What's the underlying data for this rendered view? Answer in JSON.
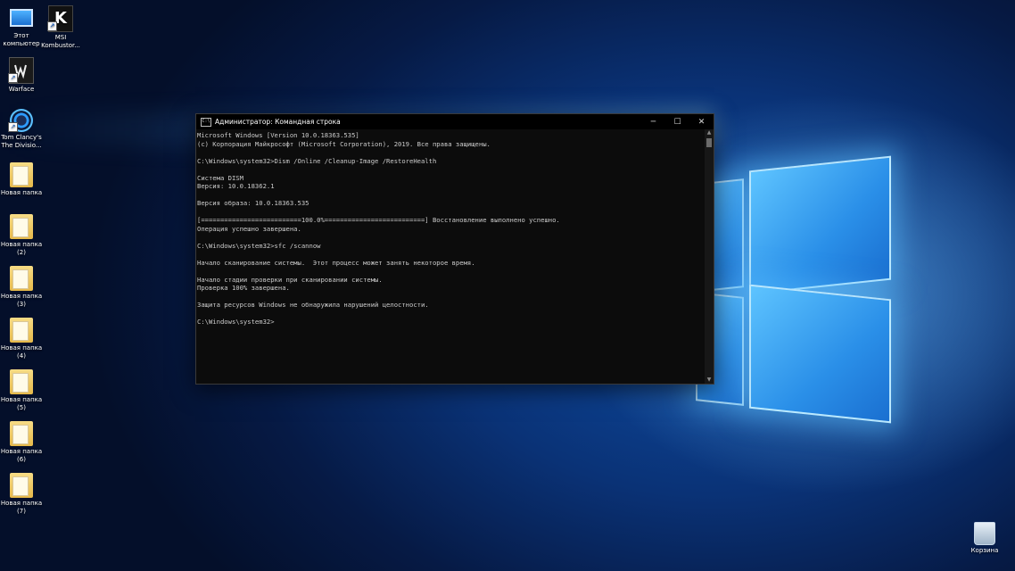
{
  "desktop": {
    "icons": [
      {
        "label": "Этот компьютер"
      },
      {
        "label": "MSI Kombustor..."
      },
      {
        "label": "Warface"
      },
      {
        "label": "Tom Clancy's The Divisio..."
      },
      {
        "label": "Новая папка"
      },
      {
        "label": "Новая папка (2)"
      },
      {
        "label": "Новая папка (3)"
      },
      {
        "label": "Новая папка (4)"
      },
      {
        "label": "Новая папка (5)"
      },
      {
        "label": "Новая папка (6)"
      },
      {
        "label": "Новая папка (7)"
      }
    ],
    "recycle_bin": {
      "label": "Корзина"
    },
    "msi_glyph": "K",
    "accent": "#0a3276"
  },
  "cmd_window": {
    "title": "Администратор: Командная строка",
    "icon_glyph": "C:\\",
    "buttons": {
      "minimize": "─",
      "maximize": "☐",
      "close": "✕"
    },
    "lines": [
      "Microsoft Windows [Version 10.0.18363.535]",
      "(c) Корпорация Майкрософт (Microsoft Corporation), 2019. Все права защищены.",
      "",
      "C:\\Windows\\system32>Dism /Online /Cleanup-Image /RestoreHealth",
      "",
      "Cистема DISM",
      "Версия: 10.0.18362.1",
      "",
      "Версия образа: 10.0.18363.535",
      "",
      "[==========================100.0%==========================] Восстановление выполнено успешно.",
      "Операция успешно завершена.",
      "",
      "C:\\Windows\\system32>sfc /scannow",
      "",
      "Начало сканирование системы.  Этот процесс может занять некоторое время.",
      "",
      "Начало стадии проверки при сканировании системы.",
      "Проверка 100% завершена.",
      "",
      "Защита ресурсов Windows не обнаружила нарушений целостности.",
      "",
      "C:\\Windows\\system32>"
    ]
  }
}
